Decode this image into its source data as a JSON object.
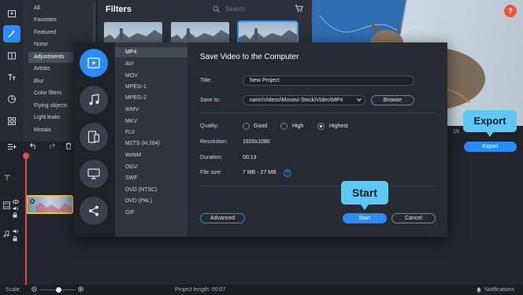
{
  "sidebar_categories": [
    {
      "label": "All"
    },
    {
      "label": "Favorites"
    },
    {
      "label": "Featured"
    },
    {
      "label": "Noise"
    },
    {
      "label": "Adjustments",
      "selected": true
    },
    {
      "label": "Artistic"
    },
    {
      "label": "Blur"
    },
    {
      "label": "Color filters"
    },
    {
      "label": "Flying objects"
    },
    {
      "label": "Light leaks"
    },
    {
      "label": "Mosaic"
    }
  ],
  "tool_icons": [
    "import-icon",
    "filters-icon",
    "transitions-icon",
    "titles-icon",
    "stickers-icon",
    "more-tools-icon"
  ],
  "filters_panel": {
    "title": "Filters",
    "search_placeholder": "Search"
  },
  "help_label": "?",
  "export": {
    "callout": "Export",
    "button_label": "Export",
    "time_readout": "16."
  },
  "status_bar": {
    "scale_label": "Scale:",
    "project_length": "Project length:  00:07",
    "notifications": "Notifications"
  },
  "dialog": {
    "title": "Save Video to the Computer",
    "formats": [
      "MP4",
      "AVI",
      "MOV",
      "MPEG-1",
      "MPEG-2",
      "WMV",
      "MKV",
      "FLV",
      "M2TS (H.264)",
      "WebM",
      "OGV",
      "SWF",
      "DVD (NTSC)",
      "DVD (PAL)",
      "GIF"
    ],
    "selected_format": "MP4",
    "title_label": "Title:",
    "title_value": "New Project",
    "save_to_label": "Save to:",
    "save_to_value": "narin\\Videos\\Movavi Stock\\Video\\MP4",
    "browse_label": "Browse",
    "quality_label": "Quality:",
    "quality_options": [
      "Good",
      "High",
      "Highest"
    ],
    "quality_selected": "Highest",
    "resolution_label": "Resolution:",
    "resolution_value": "1920x1080",
    "duration_label": "Duration:",
    "duration_value": "00:13",
    "file_size_label": "File size:",
    "file_size_value": "7 MB - 27 MB",
    "advanced_label": "Advanced",
    "start_label": "Start",
    "cancel_label": "Cancel",
    "start_callout": "Start",
    "colors": {
      "accent": "#2a8cf7",
      "callout": "#5ec8f2"
    }
  }
}
